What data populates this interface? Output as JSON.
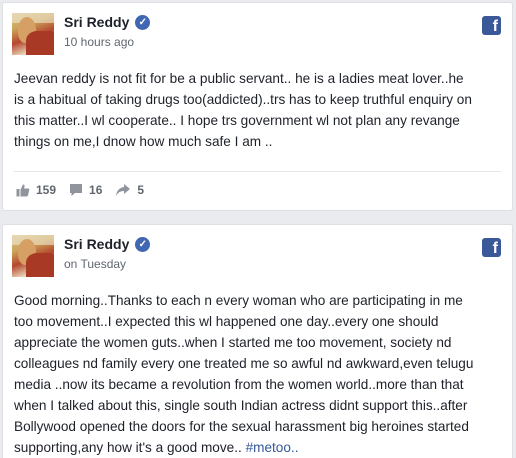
{
  "posts": [
    {
      "author": "Sri Reddy",
      "time": "10 hours ago",
      "lines": [
        "Jeevan reddy is not fit for be a public servant.. he is a ladies meat lover..he",
        "is a habitual of taking drugs too(addicted)..trs has to keep truthful enquiry on",
        "this matter..I wl cooperate.. I hope trs government wl not plan any revange",
        "things on me,I dnow how much safe I am .."
      ],
      "likes": "159",
      "comments": "16",
      "shares": "5"
    },
    {
      "author": "Sri Reddy",
      "time": "on Tuesday",
      "lines": [
        "Good morning..Thanks to each n every woman who are participating in me",
        "too movement..I expected this wl happened one day..every one should",
        "appreciate the women guts..when I started me too movement, society nd",
        "colleagues nd family every one treated me so awful nd awkward,even telugu",
        "media ..now its became a revolution from the women world..more than that",
        "when I talked about this, single south Indian actress didnt support this..after",
        "Bollywood opened the doors for the sexual harassment big heroines started",
        "supporting,any how it's a good move.."
      ],
      "hashtag": "#metoo.."
    }
  ],
  "icons": {
    "facebook": "f",
    "verified": "✓"
  },
  "colors": {
    "facebook_blue": "#3b5998",
    "verified_blue": "#4267b2",
    "link": "#365899",
    "meta_gray": "#616770"
  }
}
